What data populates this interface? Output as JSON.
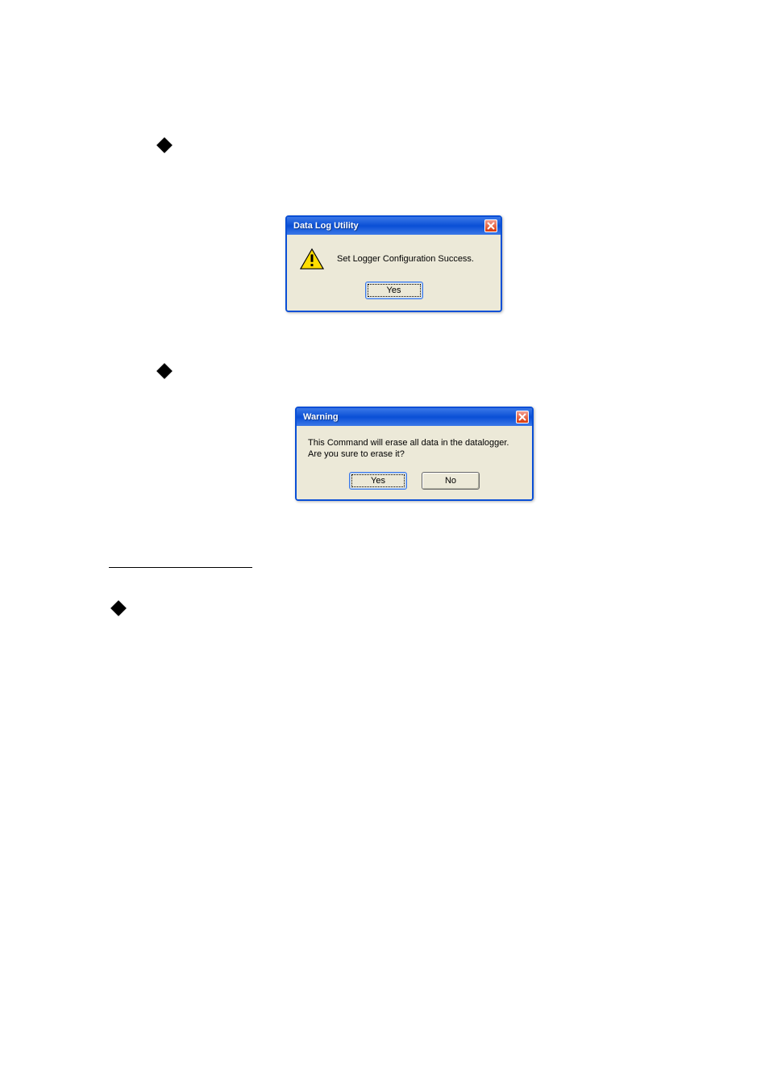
{
  "dialog1": {
    "title": "Data Log Utility",
    "message": "Set Logger Configuration Success.",
    "yes_label": "Yes"
  },
  "dialog2": {
    "title": "Warning",
    "message_line1": "This Command will erase all data in the datalogger.",
    "message_line2": "Are you sure to erase it?",
    "yes_label": "Yes",
    "no_label": "No"
  }
}
